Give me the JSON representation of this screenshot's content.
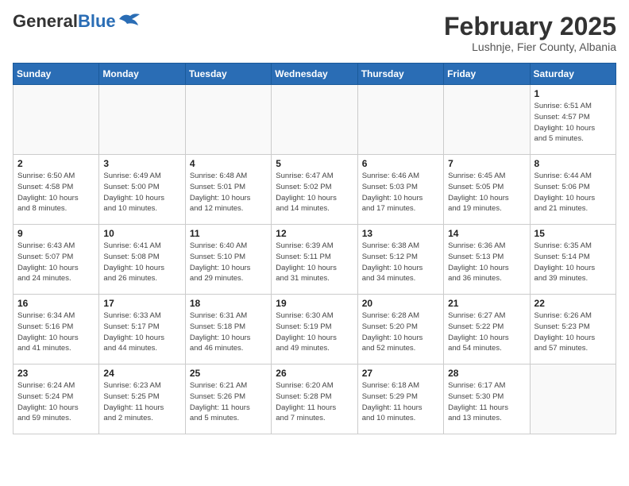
{
  "header": {
    "logo_general": "General",
    "logo_blue": "Blue",
    "month_title": "February 2025",
    "subtitle": "Lushnje, Fier County, Albania"
  },
  "days_of_week": [
    "Sunday",
    "Monday",
    "Tuesday",
    "Wednesday",
    "Thursday",
    "Friday",
    "Saturday"
  ],
  "weeks": [
    [
      {
        "day": "",
        "info": ""
      },
      {
        "day": "",
        "info": ""
      },
      {
        "day": "",
        "info": ""
      },
      {
        "day": "",
        "info": ""
      },
      {
        "day": "",
        "info": ""
      },
      {
        "day": "",
        "info": ""
      },
      {
        "day": "1",
        "info": "Sunrise: 6:51 AM\nSunset: 4:57 PM\nDaylight: 10 hours\nand 5 minutes."
      }
    ],
    [
      {
        "day": "2",
        "info": "Sunrise: 6:50 AM\nSunset: 4:58 PM\nDaylight: 10 hours\nand 8 minutes."
      },
      {
        "day": "3",
        "info": "Sunrise: 6:49 AM\nSunset: 5:00 PM\nDaylight: 10 hours\nand 10 minutes."
      },
      {
        "day": "4",
        "info": "Sunrise: 6:48 AM\nSunset: 5:01 PM\nDaylight: 10 hours\nand 12 minutes."
      },
      {
        "day": "5",
        "info": "Sunrise: 6:47 AM\nSunset: 5:02 PM\nDaylight: 10 hours\nand 14 minutes."
      },
      {
        "day": "6",
        "info": "Sunrise: 6:46 AM\nSunset: 5:03 PM\nDaylight: 10 hours\nand 17 minutes."
      },
      {
        "day": "7",
        "info": "Sunrise: 6:45 AM\nSunset: 5:05 PM\nDaylight: 10 hours\nand 19 minutes."
      },
      {
        "day": "8",
        "info": "Sunrise: 6:44 AM\nSunset: 5:06 PM\nDaylight: 10 hours\nand 21 minutes."
      }
    ],
    [
      {
        "day": "9",
        "info": "Sunrise: 6:43 AM\nSunset: 5:07 PM\nDaylight: 10 hours\nand 24 minutes."
      },
      {
        "day": "10",
        "info": "Sunrise: 6:41 AM\nSunset: 5:08 PM\nDaylight: 10 hours\nand 26 minutes."
      },
      {
        "day": "11",
        "info": "Sunrise: 6:40 AM\nSunset: 5:10 PM\nDaylight: 10 hours\nand 29 minutes."
      },
      {
        "day": "12",
        "info": "Sunrise: 6:39 AM\nSunset: 5:11 PM\nDaylight: 10 hours\nand 31 minutes."
      },
      {
        "day": "13",
        "info": "Sunrise: 6:38 AM\nSunset: 5:12 PM\nDaylight: 10 hours\nand 34 minutes."
      },
      {
        "day": "14",
        "info": "Sunrise: 6:36 AM\nSunset: 5:13 PM\nDaylight: 10 hours\nand 36 minutes."
      },
      {
        "day": "15",
        "info": "Sunrise: 6:35 AM\nSunset: 5:14 PM\nDaylight: 10 hours\nand 39 minutes."
      }
    ],
    [
      {
        "day": "16",
        "info": "Sunrise: 6:34 AM\nSunset: 5:16 PM\nDaylight: 10 hours\nand 41 minutes."
      },
      {
        "day": "17",
        "info": "Sunrise: 6:33 AM\nSunset: 5:17 PM\nDaylight: 10 hours\nand 44 minutes."
      },
      {
        "day": "18",
        "info": "Sunrise: 6:31 AM\nSunset: 5:18 PM\nDaylight: 10 hours\nand 46 minutes."
      },
      {
        "day": "19",
        "info": "Sunrise: 6:30 AM\nSunset: 5:19 PM\nDaylight: 10 hours\nand 49 minutes."
      },
      {
        "day": "20",
        "info": "Sunrise: 6:28 AM\nSunset: 5:20 PM\nDaylight: 10 hours\nand 52 minutes."
      },
      {
        "day": "21",
        "info": "Sunrise: 6:27 AM\nSunset: 5:22 PM\nDaylight: 10 hours\nand 54 minutes."
      },
      {
        "day": "22",
        "info": "Sunrise: 6:26 AM\nSunset: 5:23 PM\nDaylight: 10 hours\nand 57 minutes."
      }
    ],
    [
      {
        "day": "23",
        "info": "Sunrise: 6:24 AM\nSunset: 5:24 PM\nDaylight: 10 hours\nand 59 minutes."
      },
      {
        "day": "24",
        "info": "Sunrise: 6:23 AM\nSunset: 5:25 PM\nDaylight: 11 hours\nand 2 minutes."
      },
      {
        "day": "25",
        "info": "Sunrise: 6:21 AM\nSunset: 5:26 PM\nDaylight: 11 hours\nand 5 minutes."
      },
      {
        "day": "26",
        "info": "Sunrise: 6:20 AM\nSunset: 5:28 PM\nDaylight: 11 hours\nand 7 minutes."
      },
      {
        "day": "27",
        "info": "Sunrise: 6:18 AM\nSunset: 5:29 PM\nDaylight: 11 hours\nand 10 minutes."
      },
      {
        "day": "28",
        "info": "Sunrise: 6:17 AM\nSunset: 5:30 PM\nDaylight: 11 hours\nand 13 minutes."
      },
      {
        "day": "",
        "info": ""
      }
    ]
  ]
}
